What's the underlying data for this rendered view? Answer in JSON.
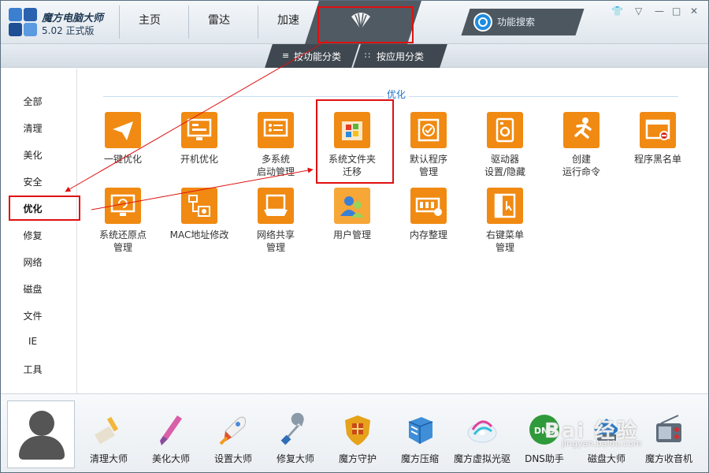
{
  "app": {
    "name": "魔方电脑大师",
    "version": "5.02 正式版"
  },
  "nav": {
    "tabs": [
      {
        "label": "主页"
      },
      {
        "label": "雷达"
      },
      {
        "label": "加速"
      }
    ],
    "search_label": "功能搜索"
  },
  "subnav": {
    "by_function": "按功能分类",
    "by_app": "按应用分类"
  },
  "sidebar": {
    "items": [
      {
        "label": "全部"
      },
      {
        "label": "清理"
      },
      {
        "label": "美化"
      },
      {
        "label": "安全"
      },
      {
        "label": "优化"
      },
      {
        "label": "修复"
      },
      {
        "label": "网络"
      },
      {
        "label": "磁盘"
      },
      {
        "label": "文件"
      },
      {
        "label": "IE"
      },
      {
        "label": "工具"
      }
    ],
    "selected": "优化"
  },
  "section": {
    "title": "优化"
  },
  "tiles": [
    {
      "line1": "一键优化",
      "line2": "",
      "icon": "paper-plane-icon"
    },
    {
      "line1": "开机优化",
      "line2": "",
      "icon": "monitor-startup-icon"
    },
    {
      "line1": "多系统",
      "line2": "启动管理",
      "icon": "multi-system-icon"
    },
    {
      "line1": "系统文件夹",
      "line2": "迁移",
      "icon": "windows-folder-icon"
    },
    {
      "line1": "默认程序",
      "line2": "管理",
      "icon": "default-program-icon"
    },
    {
      "line1": "驱动器",
      "line2": "设置/隐藏",
      "icon": "drive-icon"
    },
    {
      "line1": "创建",
      "line2": "运行命令",
      "icon": "running-man-icon"
    },
    {
      "line1": "程序黑名单",
      "line2": "",
      "icon": "blacklist-icon"
    },
    {
      "line1": "系统还原点",
      "line2": "管理",
      "icon": "restore-icon"
    },
    {
      "line1": "MAC地址修改",
      "line2": "",
      "icon": "mac-address-icon"
    },
    {
      "line1": "网络共享",
      "line2": "管理",
      "icon": "network-share-icon"
    },
    {
      "line1": "用户管理",
      "line2": "",
      "icon": "users-icon"
    },
    {
      "line1": "内存整理",
      "line2": "",
      "icon": "memory-icon"
    },
    {
      "line1": "右键菜单",
      "line2": "管理",
      "icon": "context-menu-icon"
    }
  ],
  "tools": [
    {
      "label": "清理大师",
      "icon": "brush-icon"
    },
    {
      "label": "美化大师",
      "icon": "paintbrush-icon"
    },
    {
      "label": "设置大师",
      "icon": "rocket-icon"
    },
    {
      "label": "修复大师",
      "icon": "wrench-icon"
    },
    {
      "label": "魔方守护",
      "icon": "shield-icon"
    },
    {
      "label": "魔方压缩",
      "icon": "archive-icon"
    },
    {
      "label": "魔方虚拟光驱",
      "icon": "disc-icon"
    },
    {
      "label": "DNS助手",
      "icon": "dns-icon"
    },
    {
      "label": "磁盘大师",
      "icon": "disk-icon"
    },
    {
      "label": "魔方收音机",
      "icon": "radio-icon"
    }
  ],
  "watermark": {
    "text": "Bai 经验",
    "url": "jingyan.baidu.com"
  },
  "colors": {
    "accent_orange": "#f08a12",
    "annotation_red": "#e01010",
    "dark_tab": "#505a63",
    "link_blue": "#1a70c8"
  }
}
